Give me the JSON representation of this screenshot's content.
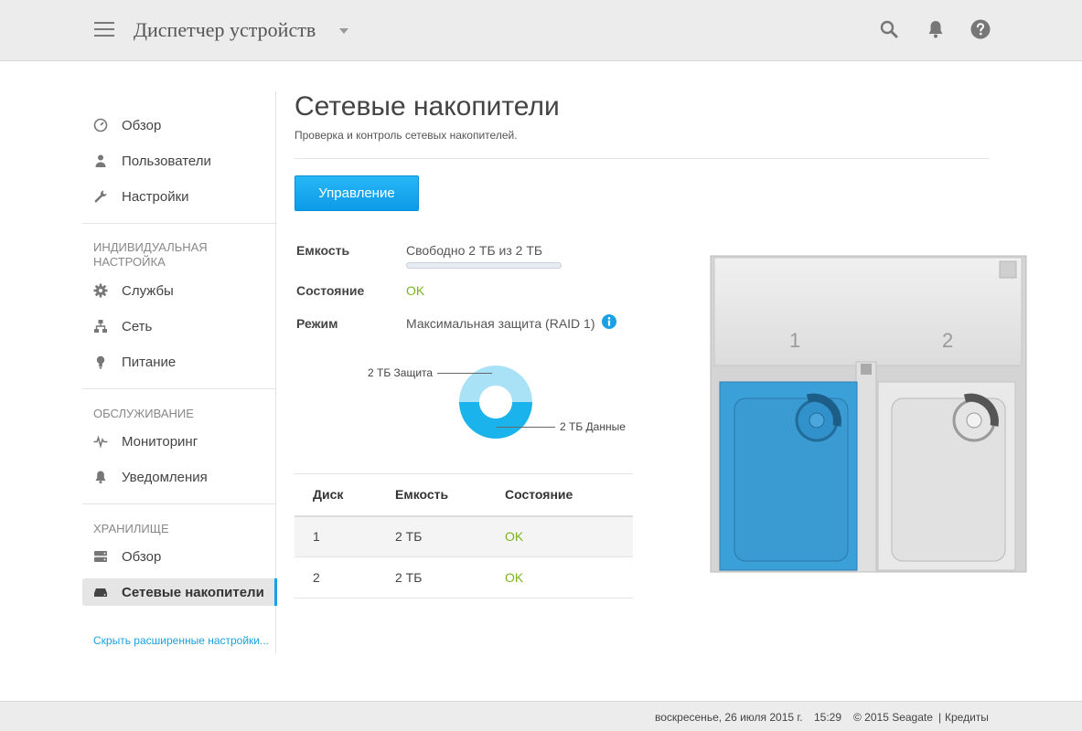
{
  "header": {
    "title": "Диспетчер устройств"
  },
  "sidebar": {
    "items": [
      {
        "label": "Обзор",
        "icon": "gauge-icon"
      },
      {
        "label": "Пользователи",
        "icon": "user-icon"
      },
      {
        "label": "Настройки",
        "icon": "wrench-icon"
      }
    ],
    "sections": [
      {
        "title": "ИНДИВИДУАЛЬНАЯ НАСТРОЙКА",
        "items": [
          {
            "label": "Службы",
            "icon": "gear-icon"
          },
          {
            "label": "Сеть",
            "icon": "network-icon"
          },
          {
            "label": "Питание",
            "icon": "bulb-icon"
          }
        ]
      },
      {
        "title": "ОБСЛУЖИВАНИЕ",
        "items": [
          {
            "label": "Мониторинг",
            "icon": "pulse-icon"
          },
          {
            "label": "Уведомления",
            "icon": "bell-icon"
          }
        ]
      },
      {
        "title": "ХРАНИЛИЩЕ",
        "items": [
          {
            "label": "Обзор",
            "icon": "storage-icon"
          },
          {
            "label": "Сетевые накопители",
            "icon": "drive-icon",
            "active": true
          }
        ]
      }
    ],
    "hide_advanced": "Скрыть расширенные настройки..."
  },
  "main": {
    "title": "Сетевые накопители",
    "subtitle": "Проверка и контроль сетевых накопителей.",
    "manage_button": "Управление",
    "properties": {
      "capacity_label": "Емкость",
      "capacity_value": "Свободно 2 ТБ из 2 ТБ",
      "capacity_used_fraction": 0,
      "status_label": "Состояние",
      "status_value": "OK",
      "mode_label": "Режим",
      "mode_value": "Максимальная защита (RAID 1)"
    },
    "donut": {
      "protection_label": "2 ТБ Защита",
      "data_label": "2 ТБ Данные",
      "protection_color": "#a9e2f7",
      "data_color": "#1ab3ec"
    },
    "table": {
      "headers": [
        "Диск",
        "Емкость",
        "Состояние"
      ],
      "rows": [
        {
          "disk": "1",
          "capacity": "2 ТБ",
          "status": "OK"
        },
        {
          "disk": "2",
          "capacity": "2 ТБ",
          "status": "OK"
        }
      ]
    },
    "device": {
      "bay1": "1",
      "bay2": "2"
    }
  },
  "footer": {
    "date": "воскресенье, 26 июля 2015 г.",
    "time": "15:29",
    "copyright": "© 2015 Seagate",
    "separator": "|",
    "credits": "Кредиты"
  },
  "colors": {
    "accent": "#1aa0e6",
    "ok": "#7ab51d",
    "disk_blue": "#3b9fd8"
  }
}
